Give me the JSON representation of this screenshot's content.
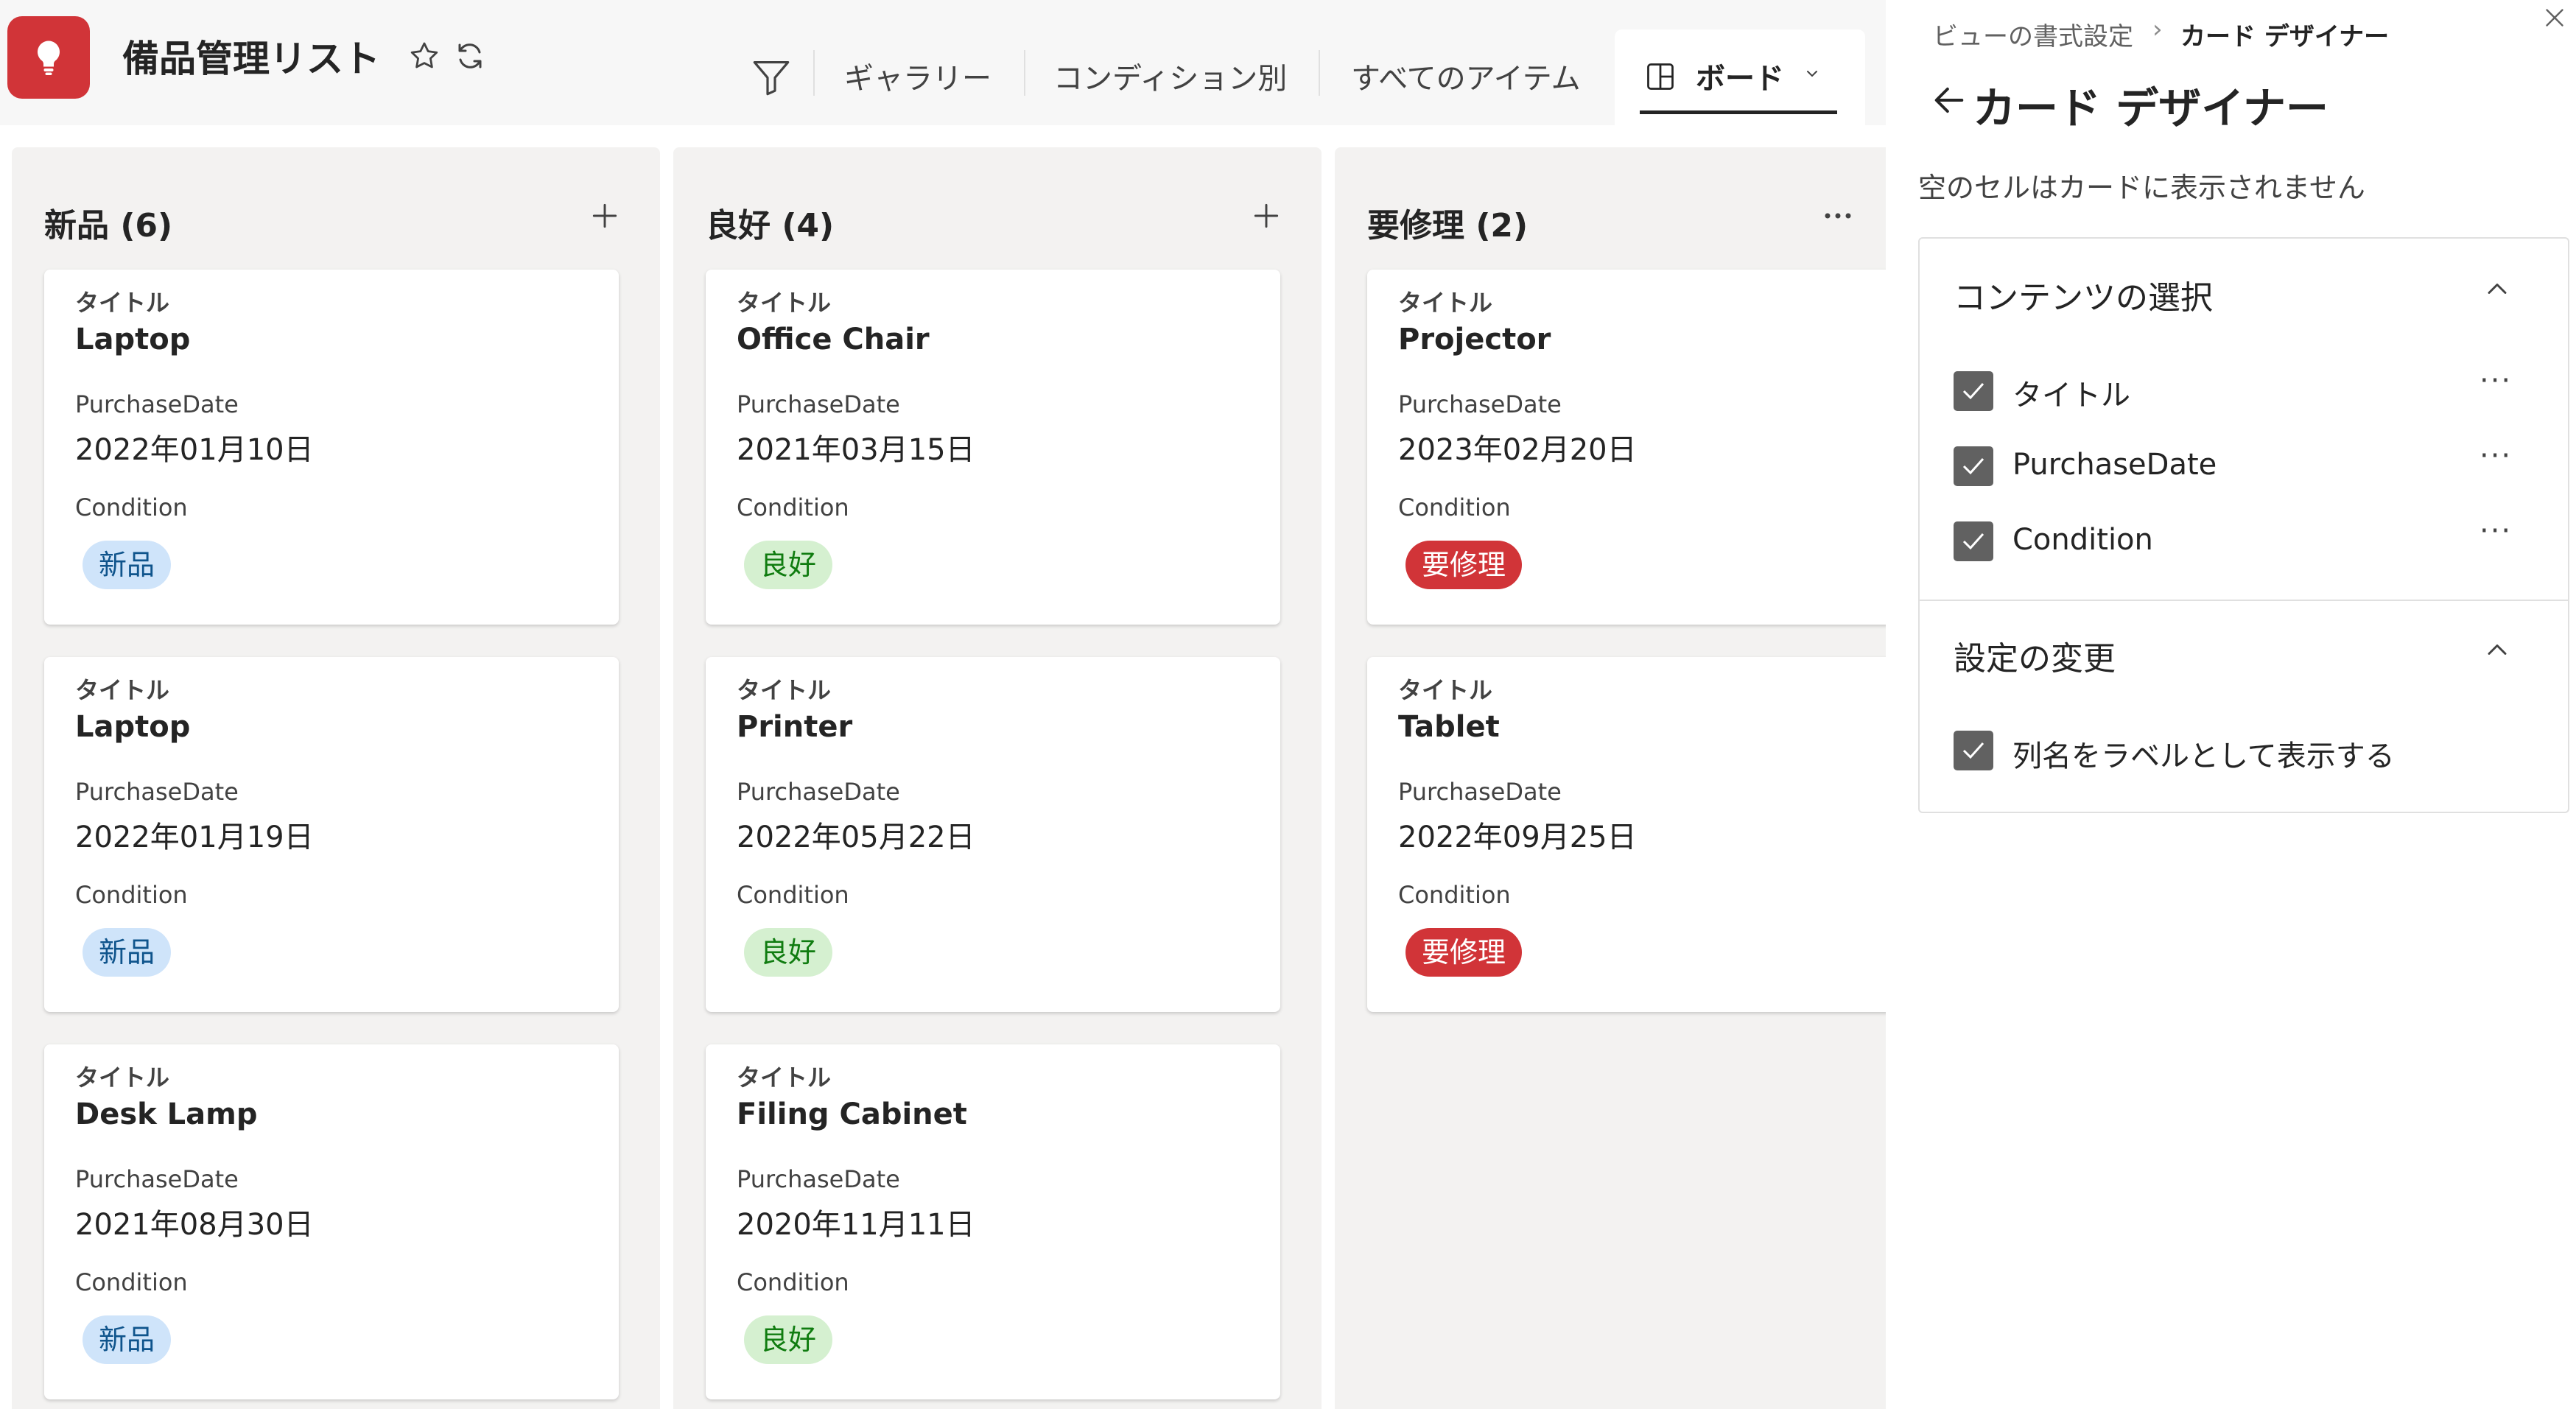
{
  "header": {
    "list_title": "備品管理リスト",
    "tabs": [
      {
        "label": "ギャラリー"
      },
      {
        "label": "コンディション別"
      },
      {
        "label": "すべてのアイテム"
      },
      {
        "label": "ボード",
        "active": true
      }
    ]
  },
  "board": {
    "columns": [
      {
        "title": "新品 (6)",
        "action_icon": "plus-icon",
        "cards": [
          {
            "title_label": "タイトル",
            "title": "Laptop",
            "date_label": "PurchaseDate",
            "date": "2022年01月10日",
            "condition_label": "Condition",
            "condition": "新品"
          },
          {
            "title_label": "タイトル",
            "title": "Laptop",
            "date_label": "PurchaseDate",
            "date": "2022年01月19日",
            "condition_label": "Condition",
            "condition": "新品"
          },
          {
            "title_label": "タイトル",
            "title": "Desk Lamp",
            "date_label": "PurchaseDate",
            "date": "2021年08月30日",
            "condition_label": "Condition",
            "condition": "新品"
          }
        ]
      },
      {
        "title": "良好 (4)",
        "action_icon": "plus-icon",
        "cards": [
          {
            "title_label": "タイトル",
            "title": "Office Chair",
            "date_label": "PurchaseDate",
            "date": "2021年03月15日",
            "condition_label": "Condition",
            "condition": "良好"
          },
          {
            "title_label": "タイトル",
            "title": "Printer",
            "date_label": "PurchaseDate",
            "date": "2022年05月22日",
            "condition_label": "Condition",
            "condition": "良好"
          },
          {
            "title_label": "タイトル",
            "title": "Filing Cabinet",
            "date_label": "PurchaseDate",
            "date": "2020年11月11日",
            "condition_label": "Condition",
            "condition": "良好"
          }
        ]
      },
      {
        "title": "要修理 (2)",
        "action_icon": "more-icon",
        "cards": [
          {
            "title_label": "タイトル",
            "title": "Projector",
            "date_label": "PurchaseDate",
            "date": "2023年02月20日",
            "condition_label": "Condition",
            "condition": "要修理"
          },
          {
            "title_label": "タイトル",
            "title": "Tablet",
            "date_label": "PurchaseDate",
            "date": "2022年09月25日",
            "condition_label": "Condition",
            "condition": "要修理"
          }
        ]
      }
    ]
  },
  "condition_colors": {
    "新品": {
      "bg": "#cfe4fa",
      "fg": "#0f548c"
    },
    "良好": {
      "bg": "#d5f0d0",
      "fg": "#107c10"
    },
    "要修理": {
      "bg": "#d13438",
      "fg": "#ffffff"
    }
  },
  "panel": {
    "breadcrumb_parent": "ビューの書式設定",
    "breadcrumb_sep": "›",
    "breadcrumb_current": "カード デザイナー",
    "title": "カード デザイナー",
    "description": "空のセルはカードに表示されません",
    "content_section": {
      "title": "コンテンツの選択",
      "items": [
        {
          "label": "タイトル",
          "checked": true
        },
        {
          "label": "PurchaseDate",
          "checked": true
        },
        {
          "label": "Condition",
          "checked": true
        }
      ]
    },
    "settings_section": {
      "title": "設定の変更",
      "items": [
        {
          "label": "列名をラベルとして表示する",
          "checked": true
        }
      ]
    },
    "more_label": "···"
  },
  "colors": {
    "brand": "#d13438",
    "board_bg": "#f3f2f1",
    "checkbox": "#616161"
  }
}
